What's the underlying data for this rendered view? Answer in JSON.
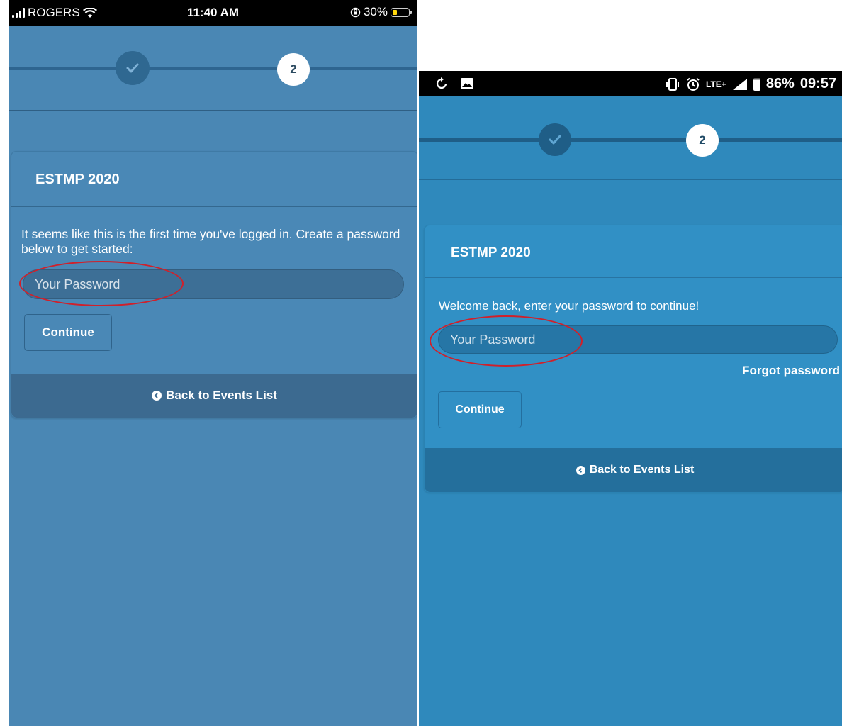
{
  "left_screen": {
    "status_bar": {
      "carrier": "ROGERS",
      "time": "11:40 AM",
      "battery_percent": "30%",
      "battery_level": 0.3
    },
    "stepper": {
      "current_step": "2"
    },
    "card": {
      "title": "ESTMP 2020",
      "message": "It seems like this is the first time you've logged in. Create a password below to get started:",
      "password_placeholder": "Your Password",
      "continue_label": "Continue",
      "back_label": "Back to Events List"
    }
  },
  "right_screen": {
    "status_bar": {
      "network": "LTE+",
      "battery_percent": "86%",
      "time": "09:57",
      "battery_level": 0.86
    },
    "stepper": {
      "current_step": "2"
    },
    "card": {
      "title": "ESTMP 2020",
      "message": "Welcome back, enter your password to continue!",
      "password_placeholder": "Your Password",
      "forgot_label": "Forgot password",
      "continue_label": "Continue",
      "back_label": "Back to Events List"
    }
  },
  "colors": {
    "left_background": "#4a87b4",
    "right_background": "#2f89bc",
    "annotation_ellipse": "#d0202a"
  }
}
